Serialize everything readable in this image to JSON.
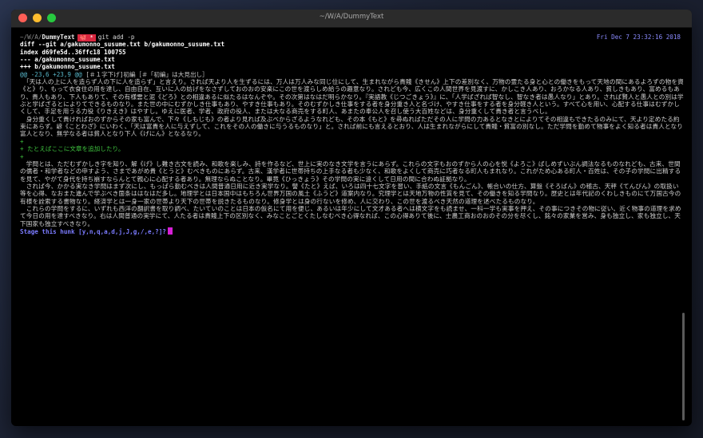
{
  "window": {
    "title": "~/W/A/DummyText"
  },
  "prompt": {
    "path": "~/W/A/",
    "dir": "DummyText",
    "branch": "🐙 *",
    "command": "git add -p",
    "datetime": "Fri Dec  7 23:32:16 2018"
  },
  "diff": {
    "header1": "diff --git a/gakumonno_susume.txt b/gakumonno_susume.txt",
    "header2": "index d69fe5d..36ffc18 100755",
    "header3": "--- a/gakumonno_susume.txt",
    "header4": "+++ b/gakumonno_susume.txt",
    "hunk_range": "@@ -23,6 +23,9 @@",
    "hunk_context": " [＃１字下げ]初編［＃「初編」は大見出し］",
    "paragraph1": "　「天は人の上に人を造らず人の下に人を造らず」と言えり。されば天より人を生ずるには、万人は万人みな同じ位にして、生まれながら貴賤《きせん》上下の差別なく、万物の霊たる身と心との働きをもって天地の間にあるよろずの物を資《と》り、もって衣食住の用を達し、自由自在、互いに人の妨げをなさずしておのおの安楽にこの世を渡らしめ給うの趣意なり。されども今、広くこの人間世界を見渡すに、かしこき人あり、おろかなる人あり、貧しきもあり、富めるもあり、貴人もあり、下人もありて、その有様雲と泥《どろ》との相違あるに似たるはなんぞや。その次第はなはだ明らかなり。『実語教《じつごきょう》』に、「人学ばざれば智なし、智なき者は愚人なり」とあり。されば賢人と愚人との別は学ぶと学ばざるとによりてできるものなり。また世の中にむずかしき仕事もあり、やすき仕事もあり。そのむずかしき仕事をする者を身分重き人と名づけ、やすき仕事をする者を身分軽き人という。すべて心を用い、心配する仕事はむずかしくして、手足を用うる力役《りきえき》はやすし。ゆえに医者、学者、政府の役人、または大なる商売をする町人、あまたの奉公人を召し使う大百姓などは、身分重くして貴き者と言うべし。",
    "paragraph2": "　身分重くして貴ければおのずからその家も富んで、下々《しもじも》の者より見れば及ぶべからざるようなれども、その本《もと》を尋ぬればただその人に学問の力あるとなきとによりてその相違もできたるのみにて、天より定めたる約束にあらず。諺《ことわざ》にいわく、「天は富貴を人に与えずして、これをその人の働きに与うるものなり」と。されば前にも言えるとおり、人は生まれながらにして貴賤・貧富の別なし。ただ学問を勤めて物事をよく知る者は貴人となり富人となり、無学なる者は貧人となり下人《げにん》となるなり。",
    "added_blank1": "+",
    "added_line": "+ たとえばここに文章を追加したり。",
    "added_blank2": "+",
    "paragraph3": "　学問とは、ただむずかしき字を知り、解《げ》し難き古文を読み、和歌を楽しみ、詩を作るなど、世上に実のなき文学を言うにあらず。これらの文字もおのずから人の心を悦《よろこ》ばしめずいぶん調法なるものなれども、古来、世間の儒者・和学者などの申すよう、さまであがめ貴《とうと》むべきものにあらず。古来、漢学者に世帯持ちの上手なる者も少なく、和歌をよくして商売に巧者なる町人もまれなり。これがため心ある町人・百姓は、その子の学問に出精するを見て、やがて身代を持ち崩すならんとて親心に心配する者あり。無理ならぬことなり。畢竟《ひっきょう》その学問の実に遠くして日用の間に合わぬ証拠なり。",
    "paragraph4": "　されば今、かかる実なき学問はまず次にし、もっぱら勤むべきは人間普通日用に近き実学なり。譬《たと》えば、いろは四十七文字を習い、手紙の文言《もんごん》、帳合いの仕方、算盤《そろばん》の稽古、天秤《てんびん》の取扱い等を心得、なおまた進んで学ぶべき箇条ははなはだ多し。地理学とは日本国中はもちろん世界万国の風土《ふうど》道案内なり。究理学とは天地万物の性質を見て、その働きを知る学問なり。歴史とは年代記のくわしきものにて万国古今の有様を詮索する書物なり。経済学とは一身一家の世帯より天下の世帯を説きたるものなり。修身学とは身の行ないを修め、人に交わり、この世を渡るべき天然の道理を述べたるものなり。",
    "paragraph5": "　これらの学問をするに、いずれも西洋の翻訳書を取り調べ、たいていのことは日本の仮名にて用を便じ、あるいは年少にして文才ある者へは横文字をも読ませ、一科一学も実事を押え、その事につきその物に従い、近く物事の道理を求めて今日の用を達すべきなり。右は人間普通の実学にて、人たる者は貴賤上下の区別なく、みなことごとくたしなむべき心得なれば、この心得ありて後に、士農工商おのおのその分を尽くし、銘々の家業を営み、身も独立し、家も独立し、天下国家も独立すべきなり。",
    "stage_prompt": "Stage this hunk [y,n,q,a,d,j,J,g,/,e,?]?"
  },
  "colors": {
    "branch_bg": "#d8273f",
    "added": "#3ec23e",
    "hunk": "#58b7c9",
    "stage_prompt": "#7b7bff",
    "cursor": "#d61fd6"
  }
}
